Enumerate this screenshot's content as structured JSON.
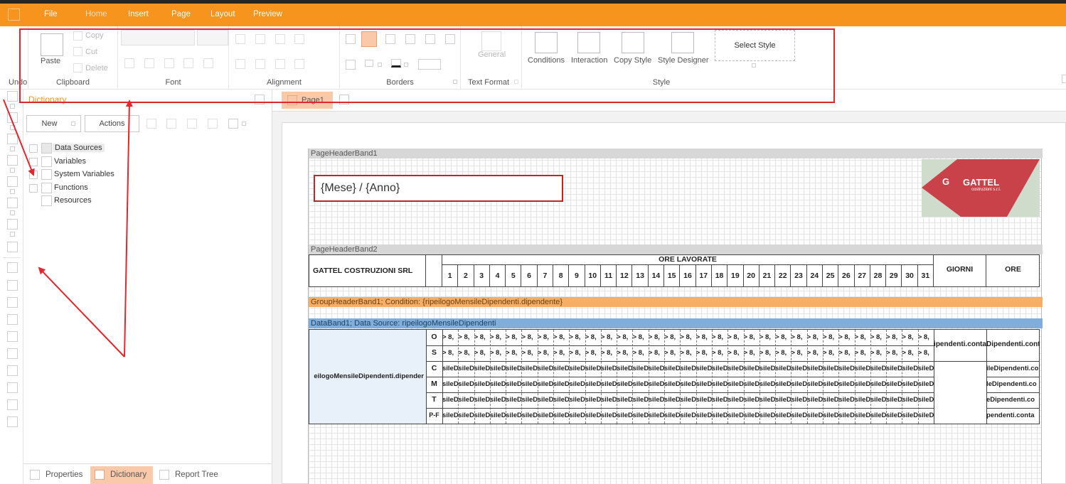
{
  "menu": {
    "items": [
      "File",
      "Home",
      "Insert",
      "Page",
      "Layout",
      "Preview"
    ],
    "active": "Home"
  },
  "ribbon": {
    "undo_label": "Undo",
    "clipboard": {
      "label": "Clipboard",
      "paste": "Paste",
      "copy": "Copy",
      "cut": "Cut",
      "delete": "Delete"
    },
    "font": {
      "label": "Font"
    },
    "alignment": {
      "label": "Alignment"
    },
    "borders": {
      "label": "Borders"
    },
    "text_format": {
      "label": "Text Format",
      "general": "General"
    },
    "style": {
      "label": "Style",
      "conditions": "Conditions",
      "interaction": "Interaction",
      "copy_style": "Copy Style",
      "style_designer": "Style Designer",
      "select_style": "Select Style"
    }
  },
  "dictionary": {
    "title": "Dictionary",
    "new_button": "New",
    "actions_button": "Actions",
    "tree": [
      "Data Sources",
      "Variables",
      "System Variables",
      "Functions",
      "Resources"
    ]
  },
  "bottom_tabs": [
    "Properties",
    "Dictionary",
    "Report Tree"
  ],
  "bottom_tab_active": "Dictionary",
  "page_tab": "Page1",
  "report": {
    "band1": "PageHeaderBand1",
    "mese_expr": "{Mese} / {Anno}",
    "logo_name": "GATTEL",
    "logo_sub": "costruzioni s.r.l.",
    "band2": "PageHeaderBand2",
    "company": "GATTEL COSTRUZIONI SRL",
    "ore_lavorate": "ORE LAVORATE",
    "days": [
      "1",
      "2",
      "3",
      "4",
      "5",
      "6",
      "7",
      "8",
      "9",
      "10",
      "11",
      "12",
      "13",
      "14",
      "15",
      "16",
      "17",
      "18",
      "19",
      "20",
      "21",
      "22",
      "23",
      "24",
      "25",
      "26",
      "27",
      "28",
      "29",
      "30",
      "31"
    ],
    "giorni": "GIORNI",
    "ore": "ORE",
    "group_band": "GroupHeaderBand1; Condition: {ripeilogoMensileDipendenti.dipendente}",
    "data_band": "DataBand1; Data Source: ripeilogoMensileDipendenti",
    "dipendente_cell": "eilogoMensileDipendenti.dipender",
    "row_codes": [
      "O",
      "S",
      "C",
      "M",
      "T",
      "P-F"
    ],
    "row_cell_text": [
      "> 8,",
      "> 8,",
      "sileD",
      "sileD",
      "sileD",
      "sileD"
    ],
    "giorni_cell": "ipendenti.conta",
    "ore_cells": [
      "Dipendenti.cont",
      "ileDipendenti.co",
      "leDipendenti.co",
      "eDipendenti.co",
      "pendenti.conta"
    ]
  },
  "colors": {
    "accent": "#f7941d",
    "highlight": "#e0282e"
  }
}
